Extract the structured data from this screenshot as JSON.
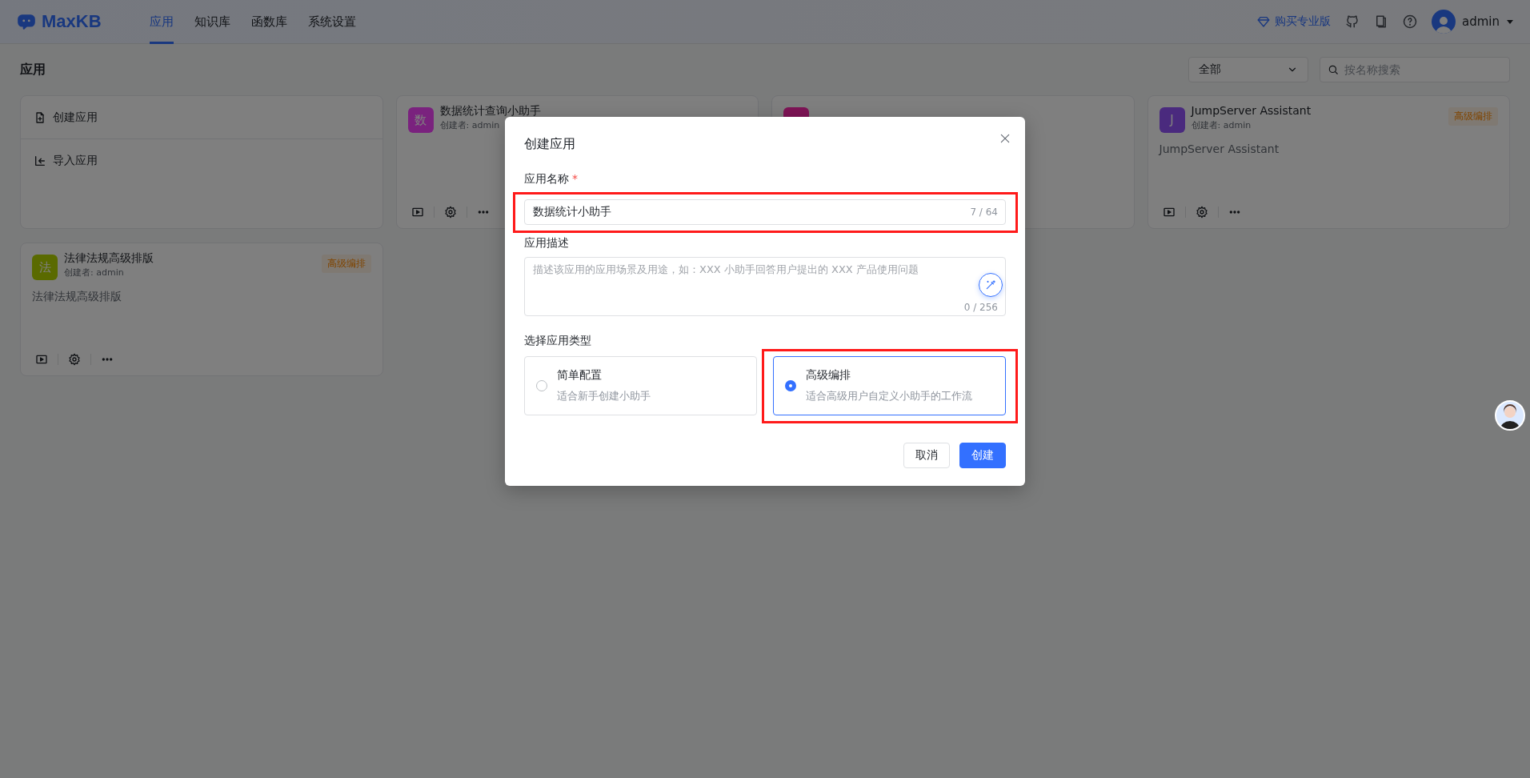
{
  "header": {
    "logo": "MaxKB",
    "nav": [
      {
        "label": "应用",
        "selected": true
      },
      {
        "label": "知识库",
        "selected": false
      },
      {
        "label": "函数库",
        "selected": false
      },
      {
        "label": "系统设置",
        "selected": false
      }
    ],
    "upgrade": "购买专业版",
    "user": "admin"
  },
  "page": {
    "title": "应用",
    "filter": {
      "value": "全部"
    },
    "search": {
      "placeholder": "按名称搜索"
    }
  },
  "create_card": {
    "actions": [
      "创建应用",
      "导入应用"
    ]
  },
  "apps": [
    {
      "avatar": "数",
      "color": "#7a227e",
      "title": "数据统计查询小助手",
      "creator": "创建者: admin"
    },
    {
      "color": "#7e1456"
    },
    {
      "avatar": "J",
      "color": "#4a2a7e",
      "title": "JumpServer Assistant",
      "creator": "创建者: admin",
      "badge": "高级编排",
      "description": "JumpServer Assistant"
    },
    {
      "avatar": "法",
      "color": "#5a6a00",
      "title": "法律法规高级排版",
      "creator": "创建者: admin",
      "badge": "高级编排",
      "description": "法律法规高级排版"
    }
  ],
  "dialog": {
    "title": "创建应用",
    "name_field": {
      "label": "应用名称",
      "required_mark": "*",
      "value": "数据统计小助手",
      "counter": "7 / 64",
      "highlighted": true
    },
    "description_field": {
      "label": "应用描述",
      "placeholder": "描述该应用的应用场景及用途，如：XXX 小助手回答用户提出的 XXX 产品使用问题",
      "counter": "0 / 256"
    },
    "type_label": "选择应用类型",
    "types": [
      {
        "title": "简单配置",
        "description": "适合新手创建小助手",
        "selected": false,
        "highlighted": false
      },
      {
        "title": "高级编排",
        "description": "适合高级用户自定义小助手的工作流",
        "selected": true,
        "highlighted": true
      }
    ],
    "buttons": {
      "cancel": "取消",
      "create": "创建"
    }
  }
}
